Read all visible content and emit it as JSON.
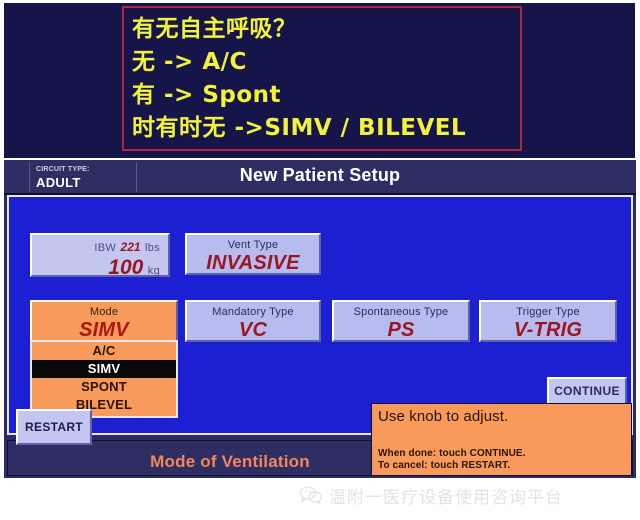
{
  "annotation": {
    "lines": [
      "有无自主呼吸？",
      "无 ->  A/C",
      "有 ->  Spont",
      "时有时无 ->SIMV / BILEVEL"
    ],
    "border_color": "#b4243c",
    "text_color": "#f2f23a",
    "background_color": "#15154a"
  },
  "ventilator": {
    "header": {
      "circuit_type_label": "CIRCUIT TYPE:",
      "circuit_type_value": "ADULT",
      "title": "New Patient Setup"
    },
    "ibw": {
      "label": "IBW",
      "lbs_value": "221",
      "lbs_unit": "lbs",
      "kg_value": "100",
      "kg_unit": "kg"
    },
    "params": [
      {
        "label": "Vent Type",
        "value": "INVASIVE",
        "selected": false
      },
      {
        "label": "Mode",
        "value": "SIMV",
        "selected": true
      },
      {
        "label": "Mandatory Type",
        "value": "VC",
        "selected": false
      },
      {
        "label": "Spontaneous Type",
        "value": "PS",
        "selected": false
      },
      {
        "label": "Trigger Type",
        "value": "V-TRIG",
        "selected": false
      }
    ],
    "mode_dropdown": {
      "options": [
        "A/C",
        "SIMV",
        "SPONT",
        "BILEVEL"
      ],
      "selected": "SIMV"
    },
    "continue_label": "CONTINUE",
    "restart_label": "RESTART",
    "footer_label": "Mode of Ventilation",
    "instructions": {
      "main": "Use knob to adjust.",
      "line1": "When done: touch CONTINUE.",
      "line2": "To cancel: touch RESTART."
    },
    "colors": {
      "panel_blue": "#1c1fd2",
      "selected_orange": "#f79a5c",
      "button_lavender": "#b6bcee",
      "value_red": "#9c1622",
      "header_navy": "#2e2e63"
    }
  },
  "watermark": {
    "icon": "wechat-icon",
    "text": "温附一医疗设备使用咨询平台"
  }
}
